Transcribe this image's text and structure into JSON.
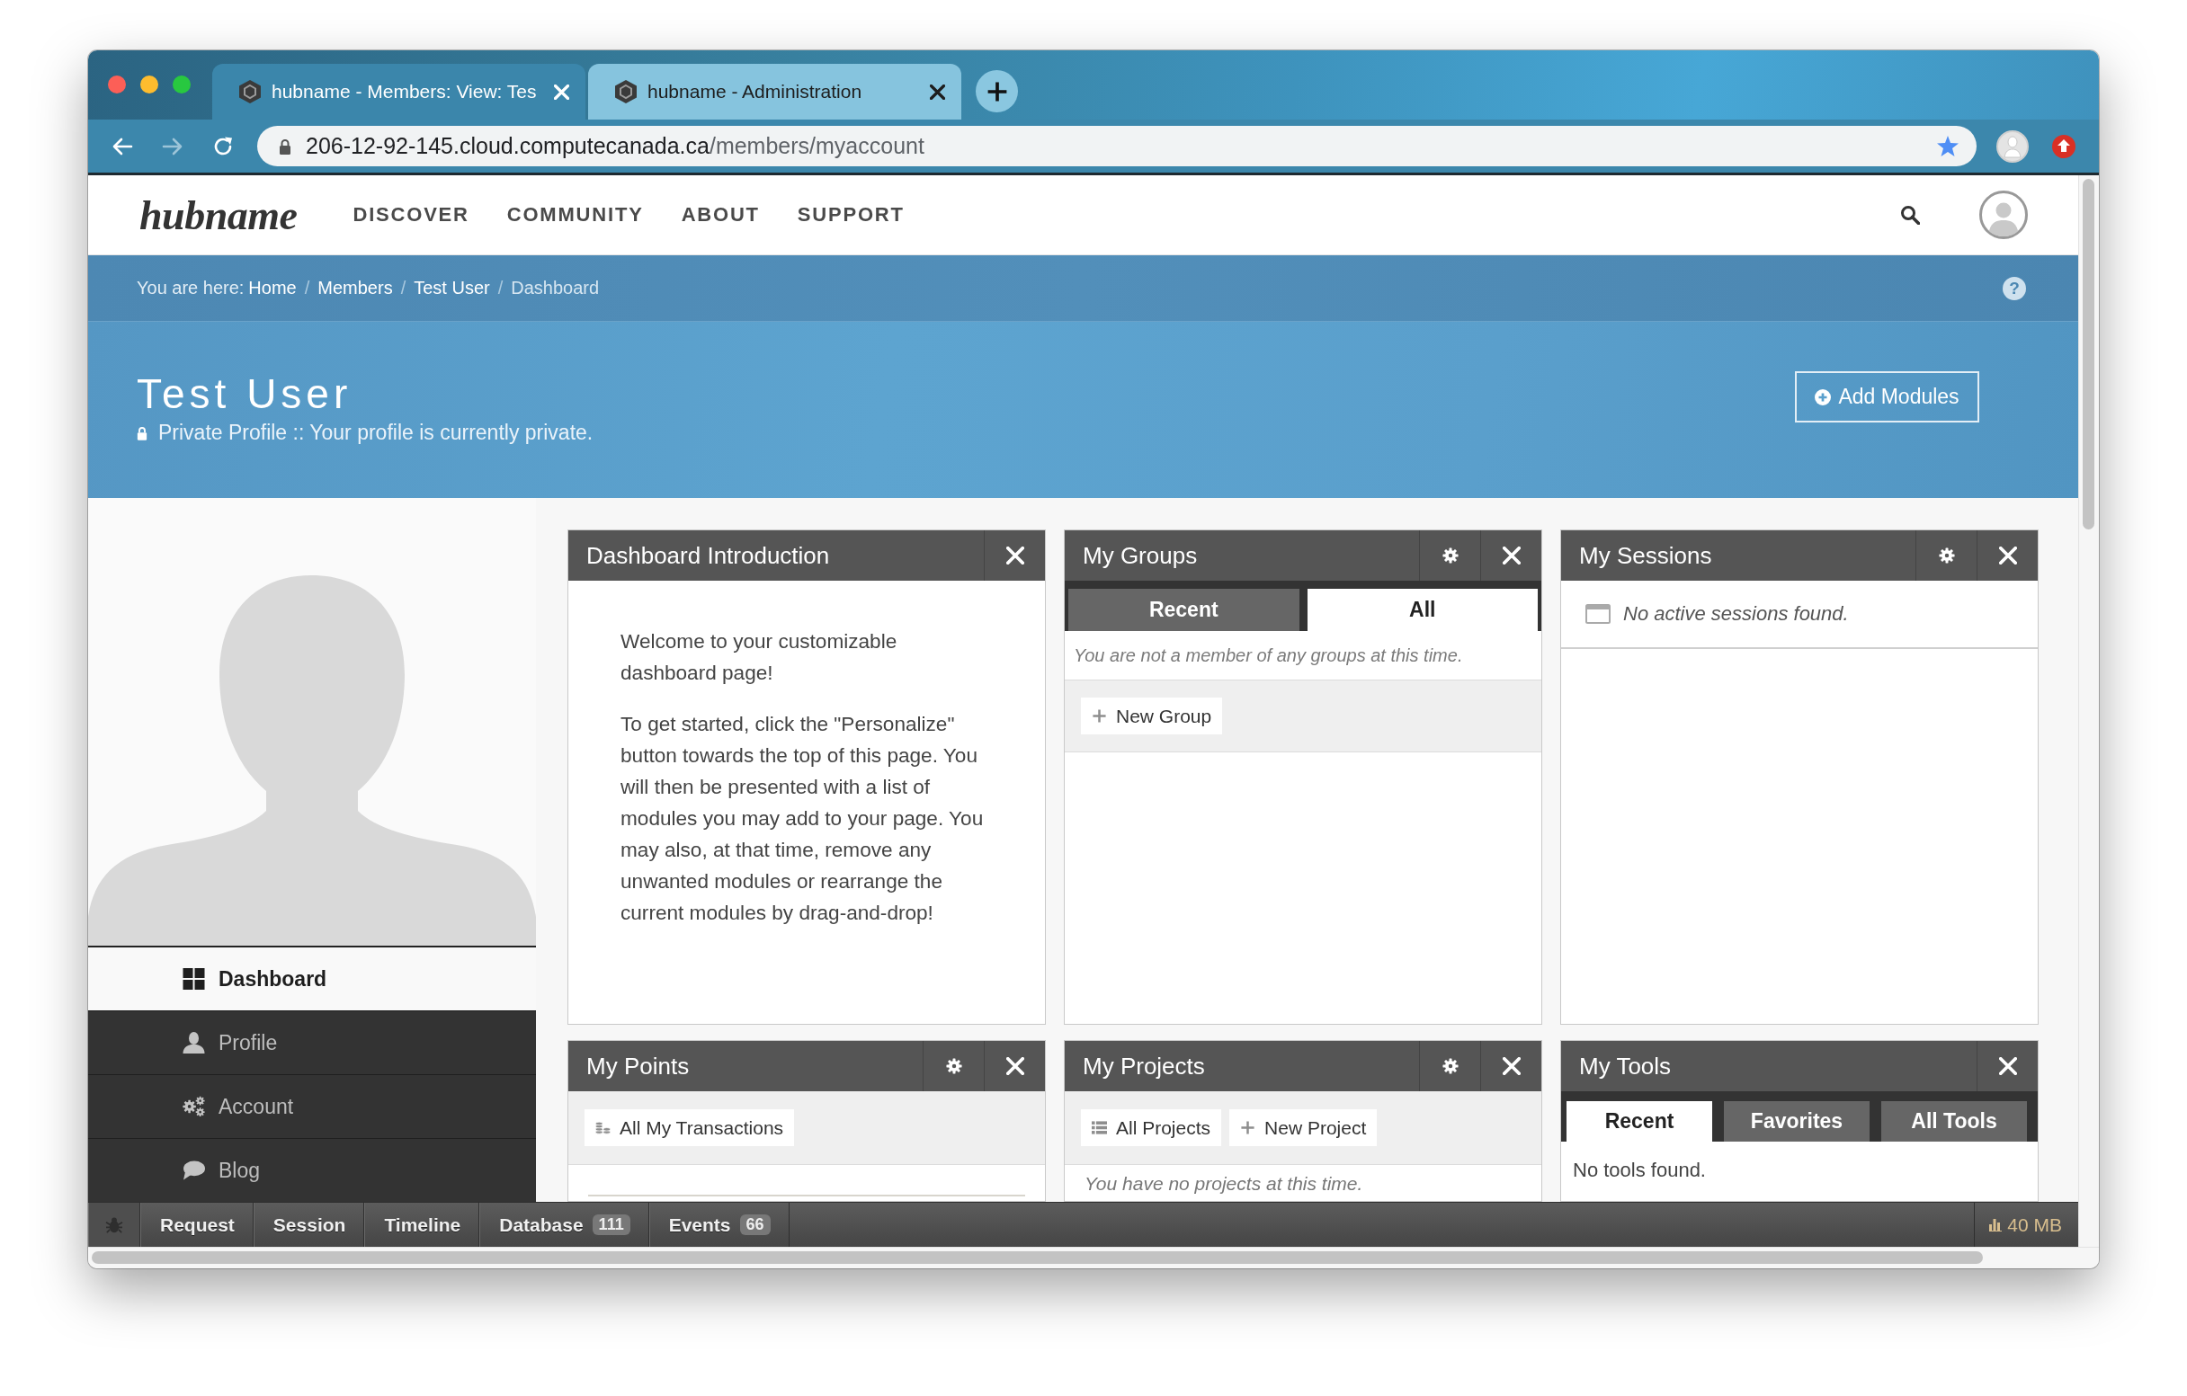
{
  "browser": {
    "tabs": [
      {
        "title": "hubname - Members: View: Tes",
        "selected": true
      },
      {
        "title": "hubname - Administration",
        "selected": false
      }
    ],
    "url": {
      "host": "206-12-92-145.cloud.computecanada.ca",
      "path": "/members/myaccount"
    }
  },
  "site_header": {
    "logo": "hubname",
    "nav": [
      "DISCOVER",
      "COMMUNITY",
      "ABOUT",
      "SUPPORT"
    ]
  },
  "breadcrumb": {
    "prefix": "You are here:",
    "items": [
      {
        "label": "Home",
        "current": false
      },
      {
        "separator": "/",
        "label": "Members",
        "current": false
      },
      {
        "separator": "/",
        "label": "Test User",
        "current": false
      },
      {
        "separator": "/",
        "label": "Dashboard",
        "current": true
      }
    ],
    "help": "?"
  },
  "hero": {
    "title": "Test User",
    "privacy": "Private Profile :: Your profile is currently private.",
    "button": "Add Modules"
  },
  "sidebar": {
    "items": [
      {
        "label": "Dashboard",
        "selected": true
      },
      {
        "label": "Profile",
        "selected": false
      },
      {
        "label": "Account",
        "selected": false
      },
      {
        "label": "Blog",
        "selected": false
      }
    ]
  },
  "modules": [
    {
      "kind": "text",
      "title": "Dashboard Introduction",
      "settings": false,
      "paragraphs": [
        "Welcome to your customizable dashboard page!",
        "To get started, click the \"Personalize\" button towards the top of this page. You will then be presented with a list of modules you may add to your page. You may also, at that time, remove any unwanted modules or rearrange the current modules by drag-and-drop!"
      ]
    },
    {
      "kind": "groups",
      "title": "My Groups",
      "settings": true,
      "tabs": [
        {
          "label": "Recent",
          "selected": false
        },
        {
          "label": "All",
          "selected": true
        }
      ],
      "message": "You are not a member of any groups at this time.",
      "buttons": [
        "New Group"
      ]
    },
    {
      "kind": "sessions",
      "title": "My Sessions",
      "settings": true,
      "message": "No active sessions found."
    },
    {
      "kind": "points",
      "title": "My Points",
      "settings": true,
      "buttons": [
        "All My Transactions"
      ]
    },
    {
      "kind": "projects",
      "title": "My Projects",
      "settings": true,
      "buttons": [
        "All Projects",
        "New Project"
      ],
      "message": "You have no projects at this time."
    },
    {
      "kind": "tools",
      "title": "My Tools",
      "settings": false,
      "tabs": [
        {
          "label": "Recent",
          "selected": true
        },
        {
          "label": "Favorites",
          "selected": false
        },
        {
          "label": "All Tools",
          "selected": false
        }
      ],
      "message": "No tools found."
    }
  ],
  "debug_bar": {
    "items": [
      {
        "label": "Request"
      },
      {
        "label": "Session"
      },
      {
        "label": "Timeline"
      },
      {
        "label": "Database",
        "count": "111"
      },
      {
        "label": "Events",
        "count": "66"
      }
    ],
    "memory": "40 MB"
  }
}
